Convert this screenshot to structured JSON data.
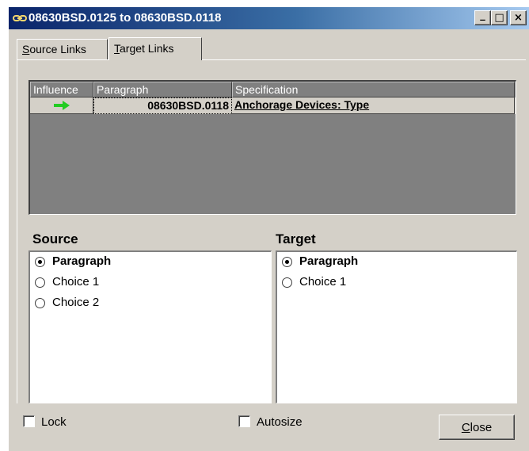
{
  "window": {
    "title": "08630BSD.0125 to 08630BSD.0118",
    "buttons": {
      "minimize": "_",
      "maximize": "□",
      "close": "×"
    }
  },
  "tabs": [
    {
      "label": "Source Links",
      "underline": "S",
      "rest": "ource Links",
      "active": false
    },
    {
      "label": "Target Links",
      "underline": "T",
      "rest": "arget Links",
      "active": true
    }
  ],
  "grid": {
    "headers": [
      "Influence",
      "Paragraph",
      "Specification"
    ],
    "rows": [
      {
        "influence_icon": "green-right-arrow-icon",
        "paragraph": "08630BSD.0118",
        "specification": "Anchorage Devices:  Type"
      }
    ]
  },
  "source": {
    "label": "Source",
    "options": [
      {
        "label": "Paragraph",
        "checked": true
      },
      {
        "label": "Choice 1",
        "checked": false
      },
      {
        "label": "Choice 2",
        "checked": false
      }
    ]
  },
  "target": {
    "label": "Target",
    "options": [
      {
        "label": "Paragraph",
        "checked": true
      },
      {
        "label": "Choice 1",
        "checked": false
      }
    ]
  },
  "footer": {
    "lock_label": "Lock",
    "autosize_label": "Autosize",
    "close_label": "Close",
    "close_underline": "C",
    "close_rest": "lose"
  },
  "colors": {
    "titlebar_start": "#0a246a",
    "titlebar_end": "#a6caf0",
    "arrow": "#22cc22",
    "face": "#d4d0c8"
  }
}
